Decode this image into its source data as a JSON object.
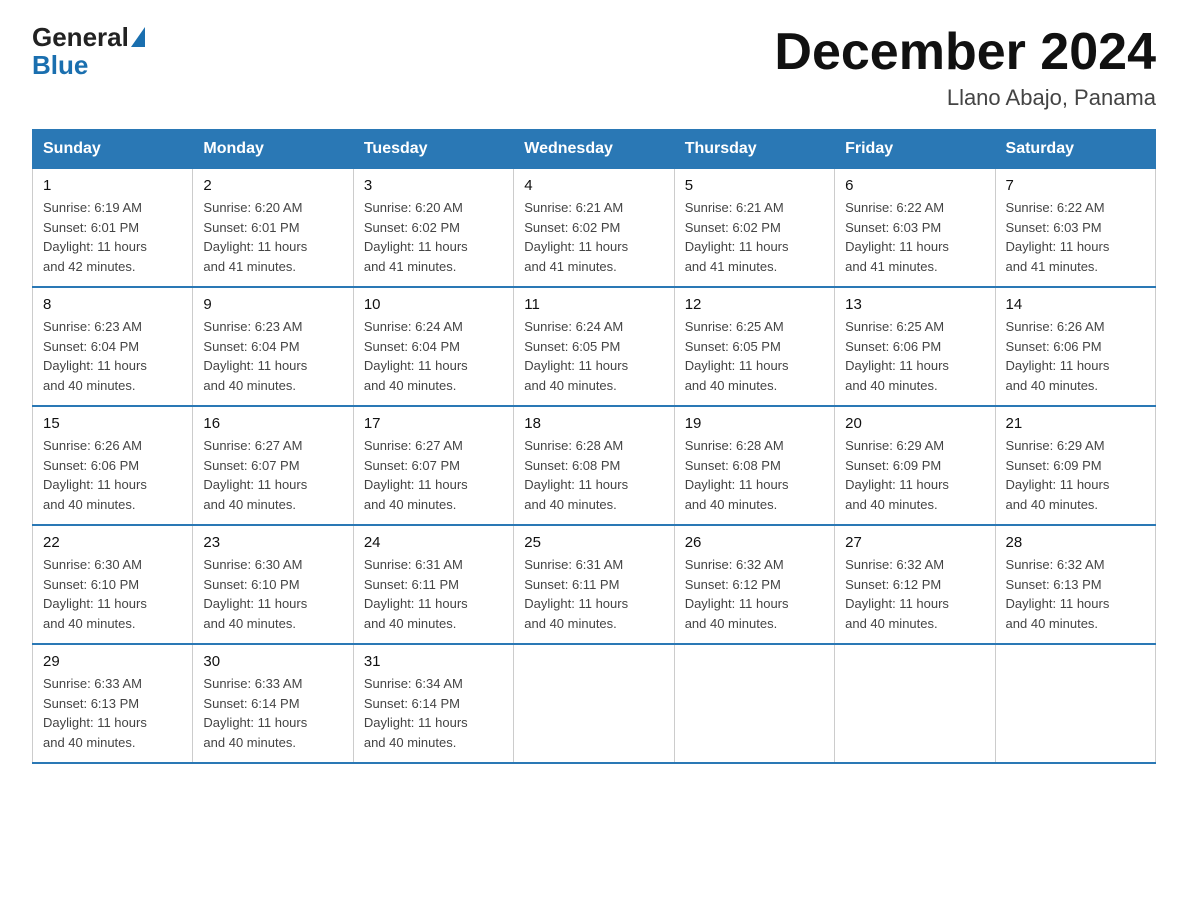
{
  "header": {
    "logo_general": "General",
    "logo_blue": "Blue",
    "month_title": "December 2024",
    "location": "Llano Abajo, Panama"
  },
  "weekdays": [
    "Sunday",
    "Monday",
    "Tuesday",
    "Wednesday",
    "Thursday",
    "Friday",
    "Saturday"
  ],
  "weeks": [
    [
      {
        "day": "1",
        "sunrise": "6:19 AM",
        "sunset": "6:01 PM",
        "daylight": "11 hours and 42 minutes."
      },
      {
        "day": "2",
        "sunrise": "6:20 AM",
        "sunset": "6:01 PM",
        "daylight": "11 hours and 41 minutes."
      },
      {
        "day": "3",
        "sunrise": "6:20 AM",
        "sunset": "6:02 PM",
        "daylight": "11 hours and 41 minutes."
      },
      {
        "day": "4",
        "sunrise": "6:21 AM",
        "sunset": "6:02 PM",
        "daylight": "11 hours and 41 minutes."
      },
      {
        "day": "5",
        "sunrise": "6:21 AM",
        "sunset": "6:02 PM",
        "daylight": "11 hours and 41 minutes."
      },
      {
        "day": "6",
        "sunrise": "6:22 AM",
        "sunset": "6:03 PM",
        "daylight": "11 hours and 41 minutes."
      },
      {
        "day": "7",
        "sunrise": "6:22 AM",
        "sunset": "6:03 PM",
        "daylight": "11 hours and 41 minutes."
      }
    ],
    [
      {
        "day": "8",
        "sunrise": "6:23 AM",
        "sunset": "6:04 PM",
        "daylight": "11 hours and 40 minutes."
      },
      {
        "day": "9",
        "sunrise": "6:23 AM",
        "sunset": "6:04 PM",
        "daylight": "11 hours and 40 minutes."
      },
      {
        "day": "10",
        "sunrise": "6:24 AM",
        "sunset": "6:04 PM",
        "daylight": "11 hours and 40 minutes."
      },
      {
        "day": "11",
        "sunrise": "6:24 AM",
        "sunset": "6:05 PM",
        "daylight": "11 hours and 40 minutes."
      },
      {
        "day": "12",
        "sunrise": "6:25 AM",
        "sunset": "6:05 PM",
        "daylight": "11 hours and 40 minutes."
      },
      {
        "day": "13",
        "sunrise": "6:25 AM",
        "sunset": "6:06 PM",
        "daylight": "11 hours and 40 minutes."
      },
      {
        "day": "14",
        "sunrise": "6:26 AM",
        "sunset": "6:06 PM",
        "daylight": "11 hours and 40 minutes."
      }
    ],
    [
      {
        "day": "15",
        "sunrise": "6:26 AM",
        "sunset": "6:06 PM",
        "daylight": "11 hours and 40 minutes."
      },
      {
        "day": "16",
        "sunrise": "6:27 AM",
        "sunset": "6:07 PM",
        "daylight": "11 hours and 40 minutes."
      },
      {
        "day": "17",
        "sunrise": "6:27 AM",
        "sunset": "6:07 PM",
        "daylight": "11 hours and 40 minutes."
      },
      {
        "day": "18",
        "sunrise": "6:28 AM",
        "sunset": "6:08 PM",
        "daylight": "11 hours and 40 minutes."
      },
      {
        "day": "19",
        "sunrise": "6:28 AM",
        "sunset": "6:08 PM",
        "daylight": "11 hours and 40 minutes."
      },
      {
        "day": "20",
        "sunrise": "6:29 AM",
        "sunset": "6:09 PM",
        "daylight": "11 hours and 40 minutes."
      },
      {
        "day": "21",
        "sunrise": "6:29 AM",
        "sunset": "6:09 PM",
        "daylight": "11 hours and 40 minutes."
      }
    ],
    [
      {
        "day": "22",
        "sunrise": "6:30 AM",
        "sunset": "6:10 PM",
        "daylight": "11 hours and 40 minutes."
      },
      {
        "day": "23",
        "sunrise": "6:30 AM",
        "sunset": "6:10 PM",
        "daylight": "11 hours and 40 minutes."
      },
      {
        "day": "24",
        "sunrise": "6:31 AM",
        "sunset": "6:11 PM",
        "daylight": "11 hours and 40 minutes."
      },
      {
        "day": "25",
        "sunrise": "6:31 AM",
        "sunset": "6:11 PM",
        "daylight": "11 hours and 40 minutes."
      },
      {
        "day": "26",
        "sunrise": "6:32 AM",
        "sunset": "6:12 PM",
        "daylight": "11 hours and 40 minutes."
      },
      {
        "day": "27",
        "sunrise": "6:32 AM",
        "sunset": "6:12 PM",
        "daylight": "11 hours and 40 minutes."
      },
      {
        "day": "28",
        "sunrise": "6:32 AM",
        "sunset": "6:13 PM",
        "daylight": "11 hours and 40 minutes."
      }
    ],
    [
      {
        "day": "29",
        "sunrise": "6:33 AM",
        "sunset": "6:13 PM",
        "daylight": "11 hours and 40 minutes."
      },
      {
        "day": "30",
        "sunrise": "6:33 AM",
        "sunset": "6:14 PM",
        "daylight": "11 hours and 40 minutes."
      },
      {
        "day": "31",
        "sunrise": "6:34 AM",
        "sunset": "6:14 PM",
        "daylight": "11 hours and 40 minutes."
      },
      null,
      null,
      null,
      null
    ]
  ],
  "labels": {
    "sunrise": "Sunrise:",
    "sunset": "Sunset:",
    "daylight": "Daylight:"
  }
}
